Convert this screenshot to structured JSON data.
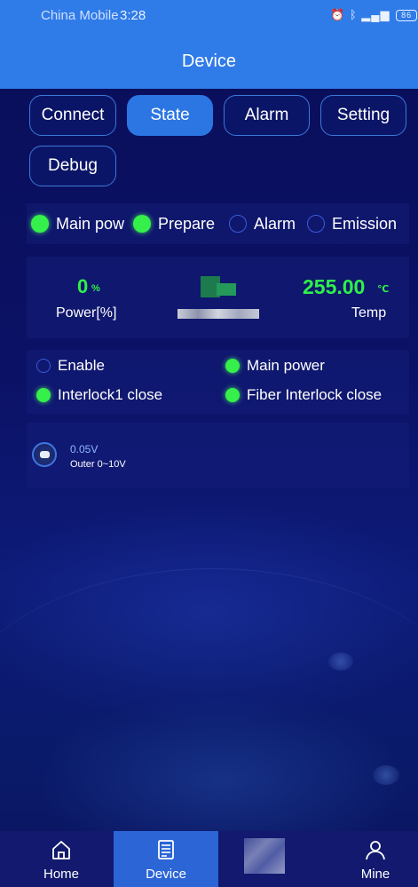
{
  "status_bar": {
    "carrier": "China Mobile",
    "time": "3:28",
    "icons": [
      "alarm-clock-icon",
      "bluetooth-icon",
      "signal-icon",
      "wifi-icon",
      "battery-icon"
    ],
    "battery_level": "86"
  },
  "header": {
    "title": "Device"
  },
  "tabs": [
    {
      "label": "Connect",
      "active": false
    },
    {
      "label": "State",
      "active": true
    },
    {
      "label": "Alarm",
      "active": false
    },
    {
      "label": "Setting",
      "active": false
    },
    {
      "label": "Debug",
      "active": false
    }
  ],
  "indicators": [
    {
      "label": "Main pow",
      "on": true
    },
    {
      "label": "Prepare",
      "on": true
    },
    {
      "label": "Alarm",
      "on": false
    },
    {
      "label": "Emission",
      "on": false
    }
  ],
  "power": {
    "value": "0",
    "unit": "%",
    "label": "Power[%]"
  },
  "temp": {
    "value": "255.00",
    "unit": "℃",
    "label": "Temp"
  },
  "status": [
    {
      "label": "Enable",
      "on": false
    },
    {
      "label": "Main power",
      "on": true
    },
    {
      "label": "Interlock1 close",
      "on": true
    },
    {
      "label": "Fiber Interlock close",
      "on": true
    }
  ],
  "voltage": {
    "value": "0.05V",
    "label": "Outer 0~10V"
  },
  "nav": [
    {
      "label": "Home",
      "icon": "home-icon",
      "active": false
    },
    {
      "label": "Device",
      "icon": "device-icon",
      "active": true
    },
    {
      "label": "",
      "icon": "blurred-icon",
      "active": false
    },
    {
      "label": "Mine",
      "icon": "user-icon",
      "active": false
    }
  ],
  "colors": {
    "header_bg": "#2f7be8",
    "active_tab": "#2b76e3",
    "led_on": "#35f04a",
    "led_off_ring": "#3a5ad8",
    "value_green": "#2ff04a",
    "page_bg": "#0b0e56",
    "nav_active": "#2b65d6"
  }
}
